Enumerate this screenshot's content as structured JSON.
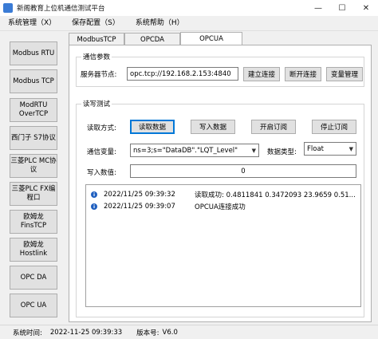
{
  "window": {
    "title": "新阁教育上位机通信测试平台",
    "minimize": "—",
    "maximize": "☐",
    "close": "✕"
  },
  "menu": [
    "系统管理（X）",
    "保存配置（S）",
    "系统帮助（H）"
  ],
  "sidebar": {
    "items": [
      "Modbus RTU",
      "Modbus TCP",
      "ModRTU OverTCP",
      "西门子 S7协议",
      "三菱PLC MC协议",
      "三菱PLC FX编程口",
      "欧姆龙 FinsTCP",
      "欧姆龙 Hostlink",
      "OPC DA",
      "OPC UA"
    ]
  },
  "tabs": [
    "ModbusTCP",
    "OPCDA",
    "OPCUA"
  ],
  "comm": {
    "group_title": "通信参数",
    "server_label": "服务器节点:",
    "server_value": "opc.tcp://192.168.2.153:4840",
    "connect": "建立连接",
    "disconnect": "断开连接",
    "var_manage": "变量管理"
  },
  "rw": {
    "group_title": "读写测试",
    "mode_label": "读取方式:",
    "read_btn": "读取数据",
    "write_btn": "写入数据",
    "open_sub": "开启订阅",
    "stop_sub": "停止订阅",
    "var_label": "通信变量:",
    "var_value": "ns=3;s=\"DataDB\".\"LQT_Level\"",
    "type_label": "数据类型:",
    "type_value": "Float",
    "write_label": "写入数值:",
    "write_value": "0"
  },
  "log": [
    {
      "time": "2022/11/25 09:39:32",
      "msg": "读取成功: 0.4811841 0.3472093 23.9659 0.51..."
    },
    {
      "time": "2022/11/25 09:39:07",
      "msg": "OPCUA连接成功"
    }
  ],
  "status": {
    "time_label": "系统时间:",
    "time_value": "2022-11-25 09:39:33",
    "version_label": "版本号:",
    "version_value": "V6.0"
  },
  "colors": {
    "accent": "#0078d7",
    "info_icon": "#1f5fbf"
  }
}
